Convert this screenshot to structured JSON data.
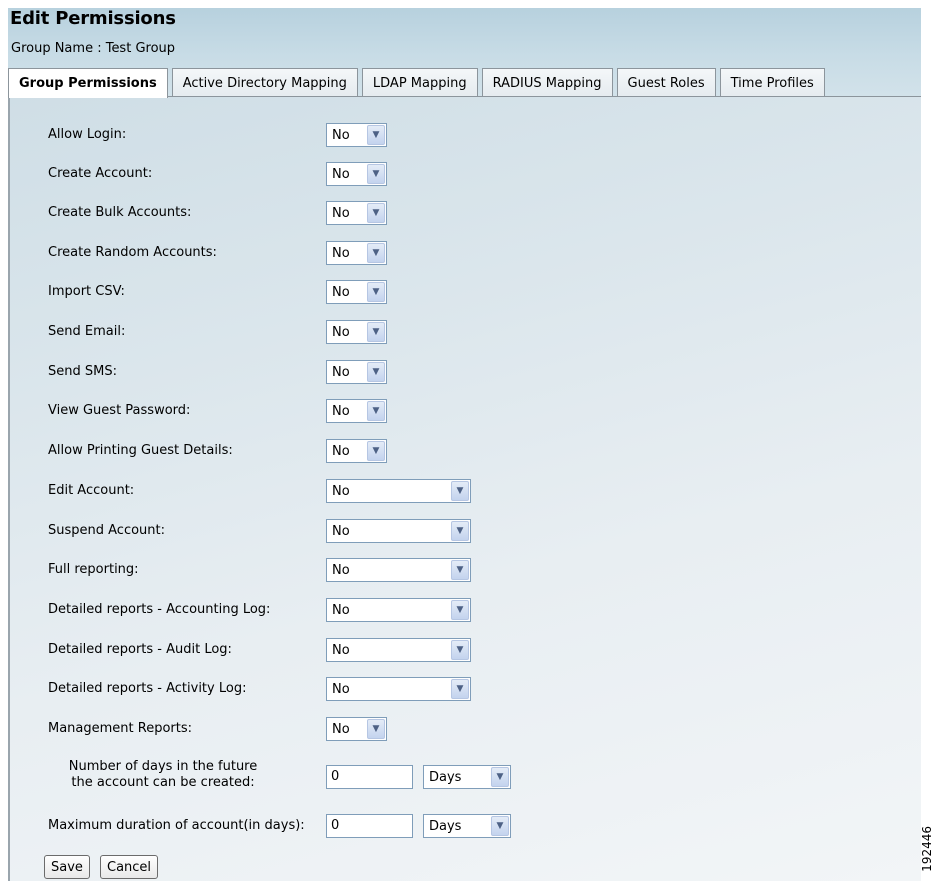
{
  "page": {
    "title": "Edit Permissions",
    "group_name": "Group Name : Test Group"
  },
  "tabs": [
    {
      "label": "Group Permissions",
      "active": true
    },
    {
      "label": "Active Directory Mapping",
      "active": false
    },
    {
      "label": "LDAP Mapping",
      "active": false
    },
    {
      "label": "RADIUS Mapping",
      "active": false
    },
    {
      "label": "Guest Roles",
      "active": false
    },
    {
      "label": "Time Profiles",
      "active": false
    }
  ],
  "permissions": {
    "allow_login": {
      "label": "Allow Login:",
      "value": "No"
    },
    "create_account": {
      "label": "Create Account:",
      "value": "No"
    },
    "create_bulk": {
      "label": "Create Bulk Accounts:",
      "value": "No"
    },
    "create_random": {
      "label": "Create Random Accounts:",
      "value": "No"
    },
    "import_csv": {
      "label": "Import CSV:",
      "value": "No"
    },
    "send_email": {
      "label": "Send Email:",
      "value": "No"
    },
    "send_sms": {
      "label": "Send SMS:",
      "value": "No"
    },
    "view_password": {
      "label": "View Guest Password:",
      "value": "No"
    },
    "allow_printing": {
      "label": "Allow Printing Guest Details:",
      "value": "No"
    },
    "edit_account": {
      "label": "Edit Account:",
      "value": "No"
    },
    "suspend_account": {
      "label": "Suspend Account:",
      "value": "No"
    },
    "full_reporting": {
      "label": "Full reporting:",
      "value": "No"
    },
    "accounting_log": {
      "label": "Detailed reports - Accounting Log:",
      "value": "No"
    },
    "audit_log": {
      "label": "Detailed reports - Audit Log:",
      "value": "No"
    },
    "activity_log": {
      "label": "Detailed reports - Activity Log:",
      "value": "No"
    },
    "management_reports": {
      "label": "Management Reports:",
      "value": "No"
    }
  },
  "future_days": {
    "label_line1": "Number of days in the future",
    "label_line2": "the account can be created:",
    "value": "0",
    "unit": "Days"
  },
  "max_duration": {
    "label": "Maximum duration of account(in days):",
    "value": "0",
    "unit": "Days"
  },
  "buttons": {
    "save": "Save",
    "cancel": "Cancel"
  },
  "side_code": "192446"
}
